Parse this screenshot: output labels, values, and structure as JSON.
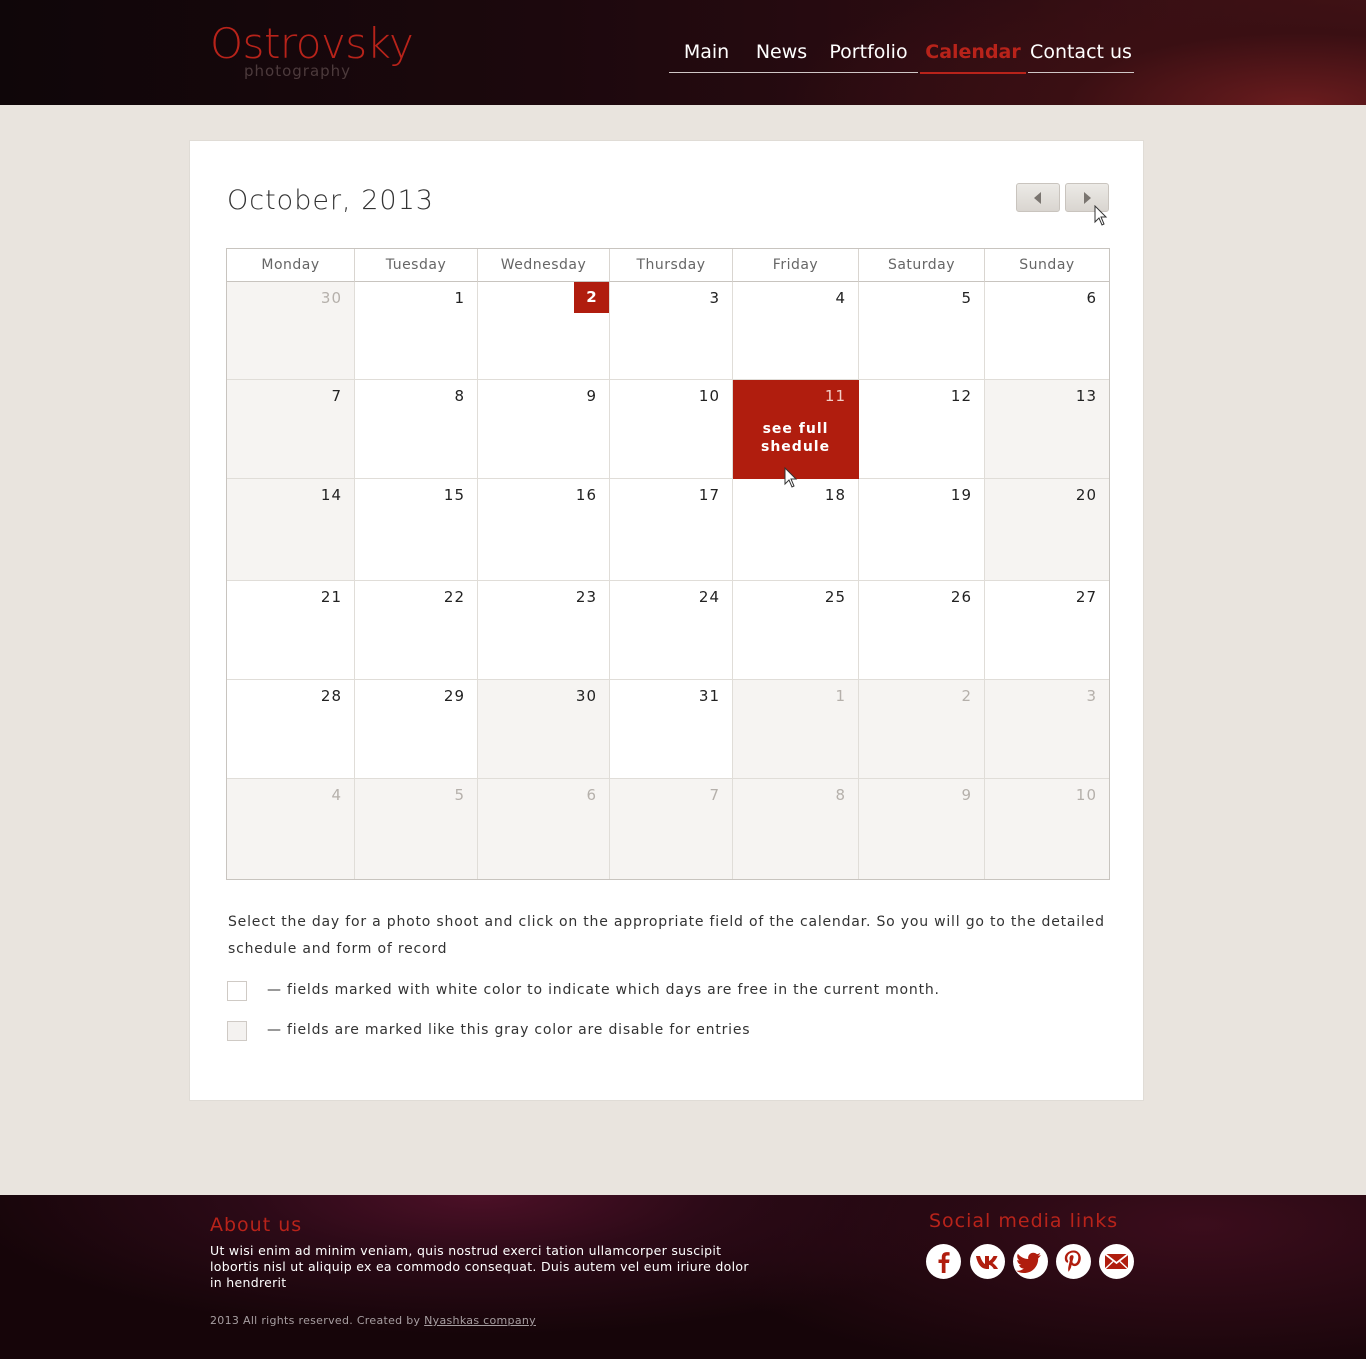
{
  "header": {
    "logo_name": "Ostrovsky",
    "logo_sub": "photography",
    "nav": [
      {
        "label": "Main",
        "active": false
      },
      {
        "label": "News",
        "active": false
      },
      {
        "label": "Portfolio",
        "active": false
      },
      {
        "label": "Calendar",
        "active": true
      },
      {
        "label": "Contact us",
        "active": false
      }
    ]
  },
  "calendar": {
    "title": "October, 2013",
    "weekdays": [
      "Monday",
      "Tuesday",
      "Wednesday",
      "Thursday",
      "Friday",
      "Saturday",
      "Sunday"
    ],
    "weeks": [
      [
        {
          "d": "30",
          "s": "out"
        },
        {
          "d": "1",
          "s": "free"
        },
        {
          "d": "2",
          "s": "today"
        },
        {
          "d": "3",
          "s": "free"
        },
        {
          "d": "4",
          "s": "free"
        },
        {
          "d": "5",
          "s": "free"
        },
        {
          "d": "6",
          "s": "free"
        }
      ],
      [
        {
          "d": "7",
          "s": "grey"
        },
        {
          "d": "8",
          "s": "free"
        },
        {
          "d": "9",
          "s": "free"
        },
        {
          "d": "10",
          "s": "free"
        },
        {
          "d": "11",
          "s": "selected"
        },
        {
          "d": "12",
          "s": "free"
        },
        {
          "d": "13",
          "s": "grey"
        }
      ],
      [
        {
          "d": "14",
          "s": "grey"
        },
        {
          "d": "15",
          "s": "free"
        },
        {
          "d": "16",
          "s": "free"
        },
        {
          "d": "17",
          "s": "free"
        },
        {
          "d": "18",
          "s": "free"
        },
        {
          "d": "19",
          "s": "free"
        },
        {
          "d": "20",
          "s": "grey"
        }
      ],
      [
        {
          "d": "21",
          "s": "free"
        },
        {
          "d": "22",
          "s": "free"
        },
        {
          "d": "23",
          "s": "free"
        },
        {
          "d": "24",
          "s": "free"
        },
        {
          "d": "25",
          "s": "free"
        },
        {
          "d": "26",
          "s": "free"
        },
        {
          "d": "27",
          "s": "free"
        }
      ],
      [
        {
          "d": "28",
          "s": "free"
        },
        {
          "d": "29",
          "s": "free"
        },
        {
          "d": "30",
          "s": "grey"
        },
        {
          "d": "31",
          "s": "free"
        },
        {
          "d": "1",
          "s": "out"
        },
        {
          "d": "2",
          "s": "out"
        },
        {
          "d": "3",
          "s": "out"
        }
      ],
      [
        {
          "d": "4",
          "s": "out"
        },
        {
          "d": "5",
          "s": "out"
        },
        {
          "d": "6",
          "s": "out"
        },
        {
          "d": "7",
          "s": "out"
        },
        {
          "d": "8",
          "s": "out"
        },
        {
          "d": "9",
          "s": "out"
        },
        {
          "d": "10",
          "s": "out"
        }
      ]
    ],
    "selected_cell_label": "see full shedule",
    "description": "Select the day for a photo shoot and click on the appropriate field of the calendar. So you will go to the detailed schedule and form  of record",
    "legend": [
      {
        "text": "— fields marked with white color to indicate which days are free in the current month.",
        "color": "#ffffff"
      },
      {
        "text": "— fields are marked like this gray color are disable for entries",
        "color": "#f6f4f2"
      }
    ],
    "accent_color": "#b01d0e"
  },
  "footer": {
    "about_title": "About us",
    "about_text": "Ut wisi enim ad minim veniam, quis nostrud exerci tation ullamcorper suscipit lobortis nisl ut aliquip ex ea commodo consequat. Duis autem vel eum iriure dolor in hendrerit",
    "copyright": "2013 All rights reserved. Created by ",
    "copyright_link": "Nyashkas company",
    "social_title": "Social media links",
    "social": [
      "facebook-icon",
      "vk-icon",
      "twitter-icon",
      "pinterest-icon",
      "mail-icon"
    ]
  }
}
